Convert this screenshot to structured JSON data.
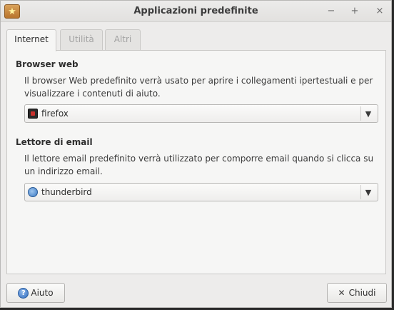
{
  "window": {
    "title": "Applicazioni predefinite",
    "minimize_symbol": "−",
    "maximize_symbol": "+",
    "close_symbol": "×",
    "app_icon_symbol": "★"
  },
  "tabs": [
    {
      "label": "Internet",
      "state": "active"
    },
    {
      "label": "Utilità",
      "state": "inactive"
    },
    {
      "label": "Altri",
      "state": "inactive"
    }
  ],
  "browser": {
    "title": "Browser web",
    "description": "Il browser Web predefinito verrà usato per aprire i collegamenti ipertestuali e per visualizzare i contenuti di aiuto.",
    "selected": "firefox",
    "icon": "firefox-icon",
    "arrow": "▼"
  },
  "email": {
    "title": "Lettore di email",
    "description": "Il lettore email predefinito verrà utilizzato per comporre email quando si clicca su un indirizzo email.",
    "selected": "thunderbird",
    "icon": "thunderbird-icon",
    "arrow": "▼"
  },
  "buttons": {
    "help_label": "Aiuto",
    "help_icon_symbol": "?",
    "close_label": "Chiudi",
    "close_icon_symbol": "✕"
  }
}
